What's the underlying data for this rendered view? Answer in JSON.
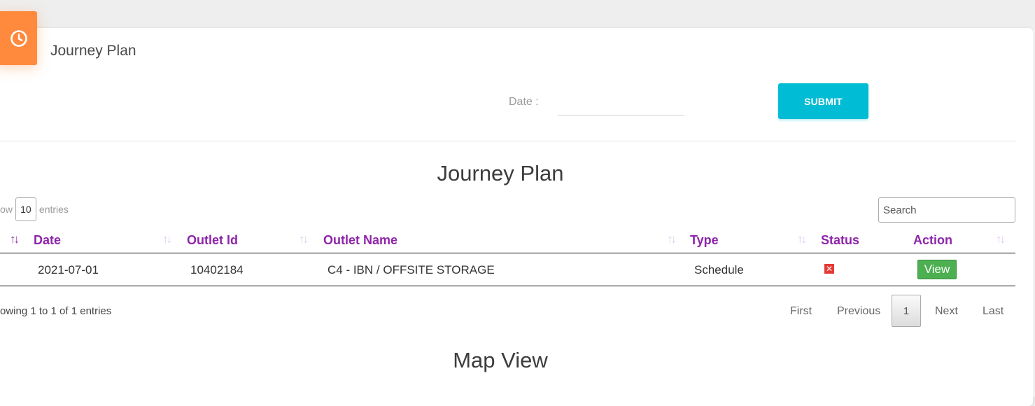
{
  "card": {
    "title": "Journey Plan"
  },
  "filter": {
    "date_label": "Date :",
    "date_value": "",
    "submit_label": "SUBMIT"
  },
  "table_section": {
    "title": "Journey Plan",
    "length_prefix": "ow",
    "length_value": "10",
    "length_suffix": "entries",
    "search_placeholder": "Search",
    "columns": [
      "Date",
      "Outlet Id",
      "Outlet Name",
      "Type",
      "Status",
      "Action"
    ],
    "sort_glyph": "↑↓",
    "rows": [
      {
        "date": "2021-07-01",
        "outlet_id": "10402184",
        "outlet_name": "C4 - IBN / OFFSITE STORAGE",
        "type": "Schedule",
        "status_icon": "close-box-icon",
        "action_label": "View"
      }
    ],
    "info": "owing 1 to 1 of 1 entries",
    "pagination": {
      "first": "First",
      "previous": "Previous",
      "current": "1",
      "next": "Next",
      "last": "Last"
    }
  },
  "map_section": {
    "title": "Map View"
  },
  "colors": {
    "accent_orange": "#ff8a3d",
    "submit": "#00bcd4",
    "header_purple": "#8e24aa",
    "view_green": "#4caf50",
    "status_red": "#e53935"
  }
}
